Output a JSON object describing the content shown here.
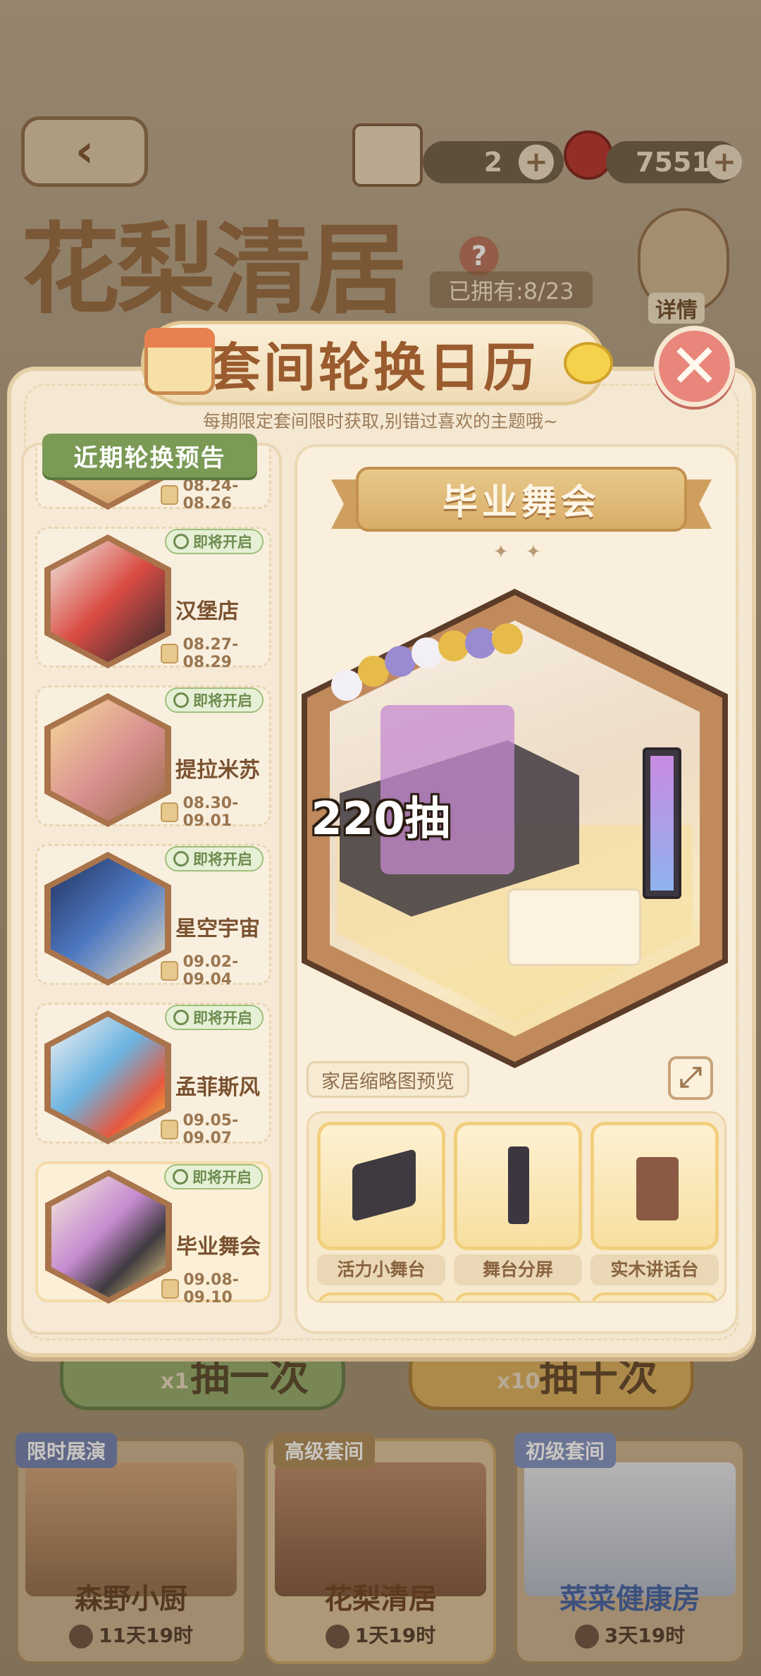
{
  "hud": {
    "back_icon": "back-arrow-icon",
    "ticket_count": "2",
    "cherry_count": "7551",
    "plus": "+",
    "details_label": "详情",
    "help": "?"
  },
  "suite": {
    "title": "花梨清居",
    "owned": "已拥有:8/23"
  },
  "modal": {
    "title": "套间轮换日历",
    "subtitle": "每期限定套间限时获取,别错过喜欢的主题哦~",
    "close": "✕",
    "left_tag": "近期轮换预告",
    "entries": [
      {
        "name": "",
        "date": "08.24-08.26",
        "badge": ""
      },
      {
        "name": "汉堡店",
        "date": "08.27-08.29",
        "badge": "即将开启"
      },
      {
        "name": "提拉米苏",
        "date": "08.30-09.01",
        "badge": "即将开启"
      },
      {
        "name": "星空宇宙",
        "date": "09.02-09.04",
        "badge": "即将开启"
      },
      {
        "name": "孟菲斯风",
        "date": "09.05-09.07",
        "badge": "即将开启"
      },
      {
        "name": "毕业舞会",
        "date": "09.08-09.10",
        "badge": "即将开启"
      }
    ],
    "detail": {
      "name": "毕业舞会",
      "sparkle": "✦ ✦",
      "pulls": "220抽",
      "preview_label": "家居缩略图预览",
      "expand_icon": "⤢",
      "items": [
        {
          "label": "活力小舞台"
        },
        {
          "label": "舞台分屏"
        },
        {
          "label": "实木讲话台"
        }
      ]
    }
  },
  "bottom": {
    "draw_one": "抽一次",
    "draw_ten": "抽十次",
    "x1": "x1",
    "x10": "x10",
    "cards": [
      {
        "tag": "限时展演",
        "name": "森野小厨",
        "time": "11天19时",
        "tag_color": "#6c7fb0",
        "name_color": "#5d3d22"
      },
      {
        "tag": "高级套间",
        "name": "花梨清居",
        "time": "1天19时",
        "tag_color": "#a98857",
        "name_color": "#6a3f1f"
      },
      {
        "tag": "初级套间",
        "name": "菜菜健康房",
        "time": "3天19时",
        "tag_color": "#7c8fc4",
        "name_color": "#3d5fa4"
      }
    ]
  }
}
